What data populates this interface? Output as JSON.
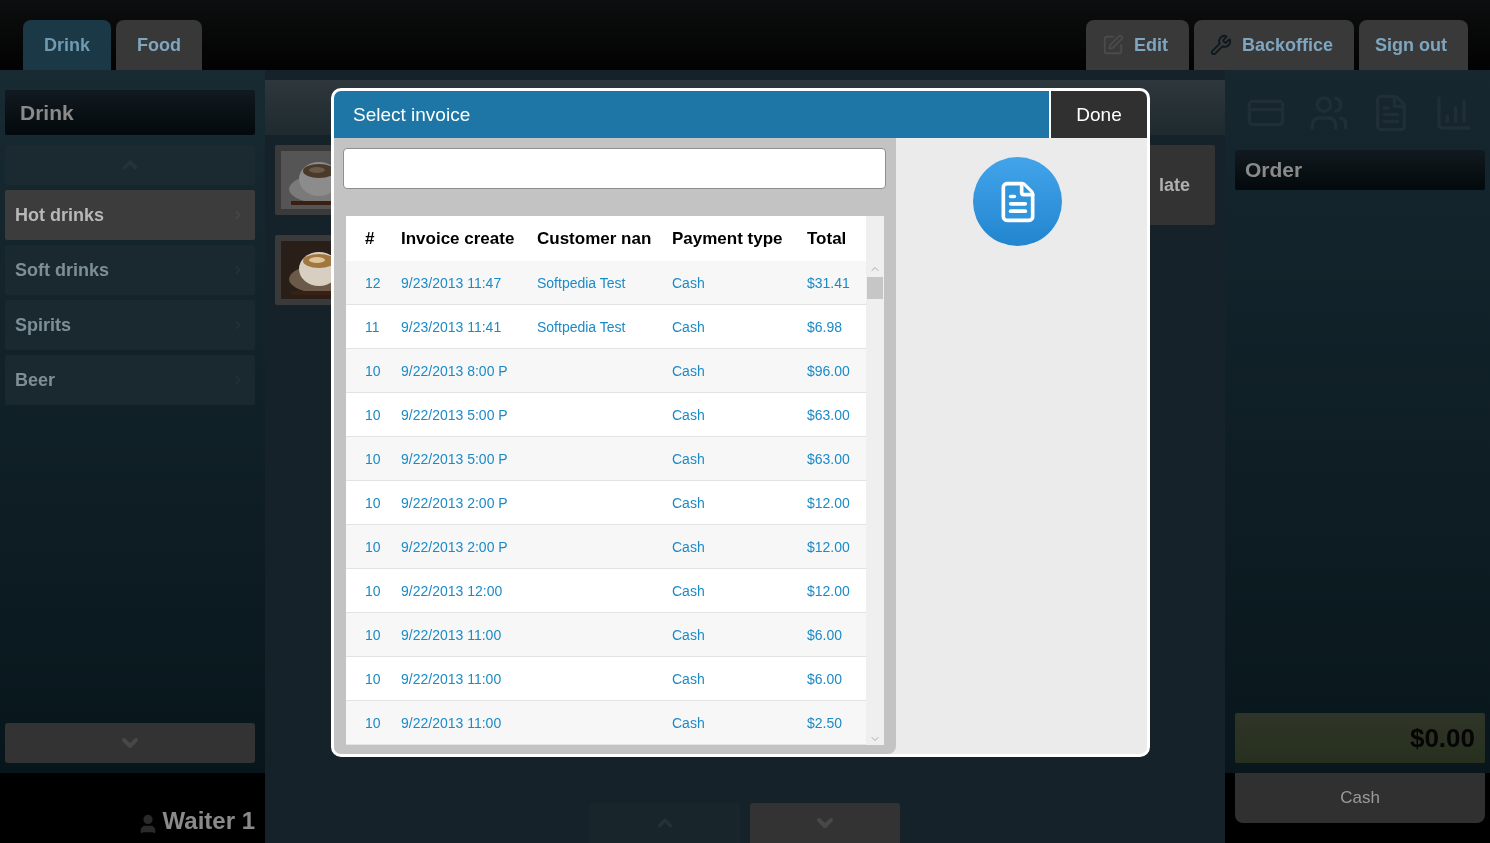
{
  "top_tabs": [
    {
      "label": "Drink",
      "selected": true
    },
    {
      "label": "Food",
      "selected": false
    }
  ],
  "top_actions": [
    {
      "label": "Edit",
      "kind": "edit"
    },
    {
      "label": "Backoffice",
      "kind": "tools"
    },
    {
      "label": "Sign out",
      "kind": "plain"
    }
  ],
  "category_panel": {
    "title": "Drink",
    "items": [
      {
        "label": "Hot drinks",
        "selected": true
      },
      {
        "label": "Soft drinks",
        "selected": false
      },
      {
        "label": "Spirits",
        "selected": false
      },
      {
        "label": "Beer",
        "selected": false
      }
    ]
  },
  "product_tile_label": "late",
  "user": {
    "name": "Waiter 1"
  },
  "order": {
    "title": "Order",
    "total": "$0.00",
    "pay_button": "Cash"
  },
  "dialog": {
    "title": "Select invoice",
    "done": "Done",
    "columns": [
      "#",
      "Invoice create",
      "Customer nan",
      "Payment type",
      "Total"
    ],
    "rows": [
      {
        "number": "12",
        "created": "9/23/2013 11:47",
        "customer": "Softpedia Test",
        "payment": "Cash",
        "total": "$31.41"
      },
      {
        "number": "11",
        "created": "9/23/2013 11:41",
        "customer": "Softpedia Test",
        "payment": "Cash",
        "total": "$6.98"
      },
      {
        "number": "10",
        "created": "9/22/2013 8:00 P",
        "payment": "Cash",
        "total": "$96.00"
      },
      {
        "number": "10",
        "created": "9/22/2013 5:00 P",
        "payment": "Cash",
        "total": "$63.00"
      },
      {
        "number": "10",
        "created": "9/22/2013 5:00 P",
        "payment": "Cash",
        "total": "$63.00"
      },
      {
        "number": "10",
        "created": "9/22/2013 2:00 P",
        "payment": "Cash",
        "total": "$12.00"
      },
      {
        "number": "10",
        "created": "9/22/2013 2:00 P",
        "payment": "Cash",
        "total": "$12.00"
      },
      {
        "number": "10",
        "created": "9/22/2013 12:00",
        "payment": "Cash",
        "total": "$12.00"
      },
      {
        "number": "10",
        "created": "9/22/2013 11:00",
        "payment": "Cash",
        "total": "$6.00"
      },
      {
        "number": "10",
        "created": "9/22/2013 11:00",
        "payment": "Cash",
        "total": "$6.00"
      },
      {
        "number": "10",
        "created": "9/22/2013 11:00",
        "payment": "Cash",
        "total": "$2.50"
      }
    ]
  }
}
